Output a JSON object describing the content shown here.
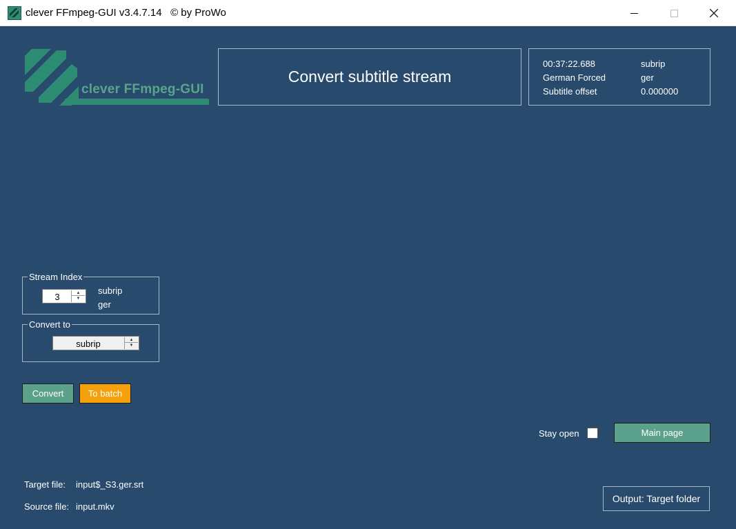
{
  "window": {
    "title": "clever FFmpeg-GUI v3.4.7.14   © by ProWo",
    "icon": "app-logo-icon"
  },
  "logo": {
    "text": "clever FFmpeg-GUI",
    "color": "#2e8b74"
  },
  "header": {
    "title": "Convert subtitle stream"
  },
  "info": {
    "duration": "00:37:22.688",
    "codec": "subrip",
    "stream_title": "German Forced",
    "language": "ger",
    "offset_label": "Subtitle offset",
    "offset_value": "0.000000"
  },
  "stream_index": {
    "legend": "Stream Index",
    "value": "3",
    "codec": "subrip",
    "language": "ger"
  },
  "convert_to": {
    "legend": "Convert to",
    "value": "subrip"
  },
  "buttons": {
    "convert": "Convert",
    "to_batch": "To batch",
    "main_page": "Main page",
    "output": "Output: Target folder"
  },
  "stay_open": {
    "label": "Stay open",
    "checked": false
  },
  "files": {
    "target_label": "Target file:",
    "target_value": "input$_S3.ger.srt",
    "source_label": "Source file:",
    "source_value": "input.mkv"
  },
  "colors": {
    "background": "#284a6c",
    "accent_green": "#5ba18b",
    "accent_orange": "#f5a10b",
    "panel_border": "#a9b7c6"
  }
}
